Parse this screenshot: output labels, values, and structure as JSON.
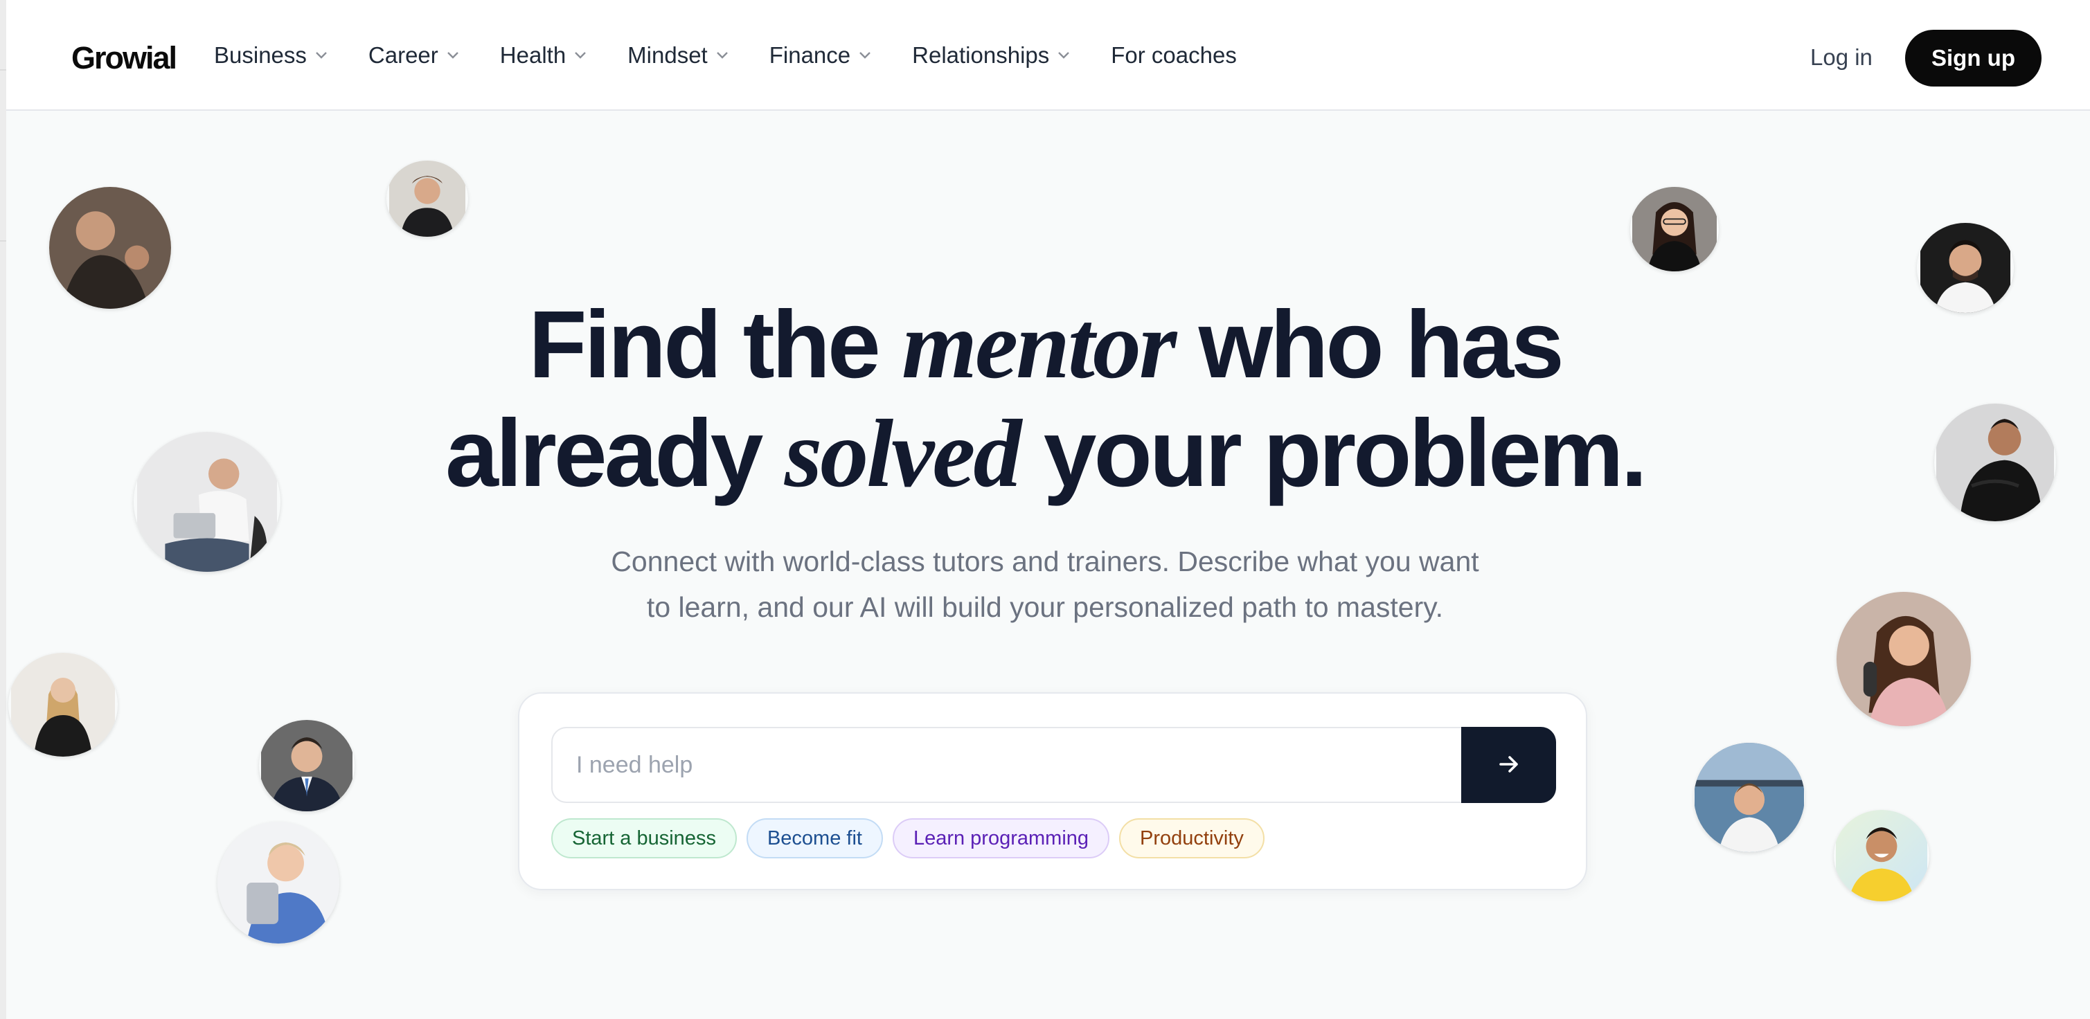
{
  "brand": {
    "logo": "Growial"
  },
  "nav": {
    "items": [
      {
        "label": "Business",
        "has_dropdown": true
      },
      {
        "label": "Career",
        "has_dropdown": true
      },
      {
        "label": "Health",
        "has_dropdown": true
      },
      {
        "label": "Mindset",
        "has_dropdown": true
      },
      {
        "label": "Finance",
        "has_dropdown": true
      },
      {
        "label": "Relationships",
        "has_dropdown": true
      },
      {
        "label": "For coaches",
        "has_dropdown": false
      }
    ],
    "login_label": "Log in",
    "signup_label": "Sign up"
  },
  "hero": {
    "line1_a": "Find the ",
    "line1_em": "mentor",
    "line1_b": " who has",
    "line2_a": "already ",
    "line2_em": "solved",
    "line2_b": " your problem.",
    "subtitle_1": "Connect with world-class tutors and trainers. Describe what you want",
    "subtitle_2": "to learn, and our AI will build your personalized path to mastery."
  },
  "search": {
    "value": "",
    "placeholder": "I need help",
    "submit_icon": "arrow-right-icon"
  },
  "suggestions": [
    {
      "label": "Start a business",
      "color": "#166534"
    },
    {
      "label": "Become fit",
      "color": "#1d4f91"
    },
    {
      "label": "Learn programming",
      "color": "#5b21b6"
    },
    {
      "label": "Productivity",
      "color": "#92400e"
    }
  ],
  "colors": {
    "primary_dark": "#111a2c",
    "signup_bg": "#0a0a0a",
    "page_bg": "#f8fafa"
  }
}
